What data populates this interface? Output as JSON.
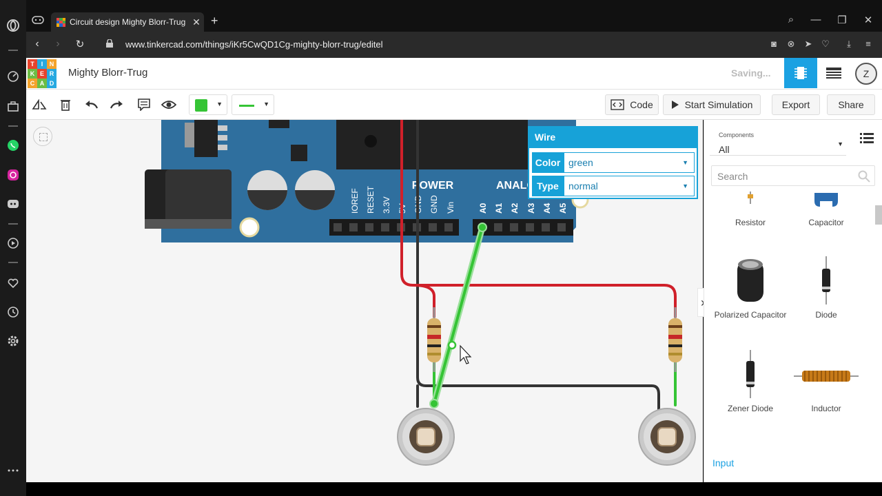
{
  "browser": {
    "tab_title": "Circuit design Mighty Blorr-Trug",
    "url": "www.tinkercad.com/things/iKr5CwQD1Cg-mighty-blorr-trug/editel",
    "icons": [
      "opera-icon",
      "gamepad-icon",
      "search-icon",
      "minimize-icon",
      "restore-icon",
      "close-icon",
      "camera-icon",
      "adblock-icon",
      "send-icon",
      "heart-icon",
      "download-icon",
      "menu-icon"
    ]
  },
  "sidebar": {
    "icons": [
      "speed-dial-icon",
      "briefcase-icon",
      "whatsapp-icon",
      "instagram-icon",
      "discord-icon",
      "player-icon",
      "heart-icon",
      "history-icon",
      "settings-icon",
      "more-icon"
    ]
  },
  "header": {
    "logo_letters": [
      "T",
      "I",
      "N",
      "K",
      "E",
      "R",
      "C",
      "A",
      "D"
    ],
    "project_title": "Mighty Blorr-Trug",
    "status": "Saving...",
    "avatar_glyph": "Z"
  },
  "toolbar": {
    "icons": [
      "rotate-icon",
      "delete-icon",
      "undo-icon",
      "redo-icon",
      "notes-icon",
      "eye-icon"
    ],
    "wire_color": "#35c435",
    "code_label": "Code",
    "simulate_label": "Start Simulation",
    "export_label": "Export",
    "share_label": "Share"
  },
  "board": {
    "power_label": "POWER",
    "analog_label": "ANALOG IN",
    "power_pins": [
      "IOREF",
      "RESET",
      "3.3V",
      "5V",
      "GND",
      "GND",
      "Vin"
    ],
    "analog_pins": [
      "A0",
      "A1",
      "A2",
      "A3",
      "A4",
      "A5"
    ]
  },
  "wire_panel": {
    "title": "Wire",
    "color_label": "Color",
    "color_value": "green",
    "type_label": "Type",
    "type_value": "normal"
  },
  "components": {
    "dropdown_small": "Components",
    "dropdown_value": "All",
    "search_placeholder": "Search",
    "items": [
      {
        "name": "Resistor"
      },
      {
        "name": "Capacitor"
      },
      {
        "name": "Polarized Capacitor"
      },
      {
        "name": "Diode"
      },
      {
        "name": "Zener Diode"
      },
      {
        "name": "Inductor"
      }
    ],
    "section_label": "Input"
  },
  "colors": {
    "accent": "#1ba1e2",
    "board": "#2f6f9e",
    "wire_red": "#d0202a",
    "wire_black": "#333333",
    "wire_green": "#35c435"
  }
}
